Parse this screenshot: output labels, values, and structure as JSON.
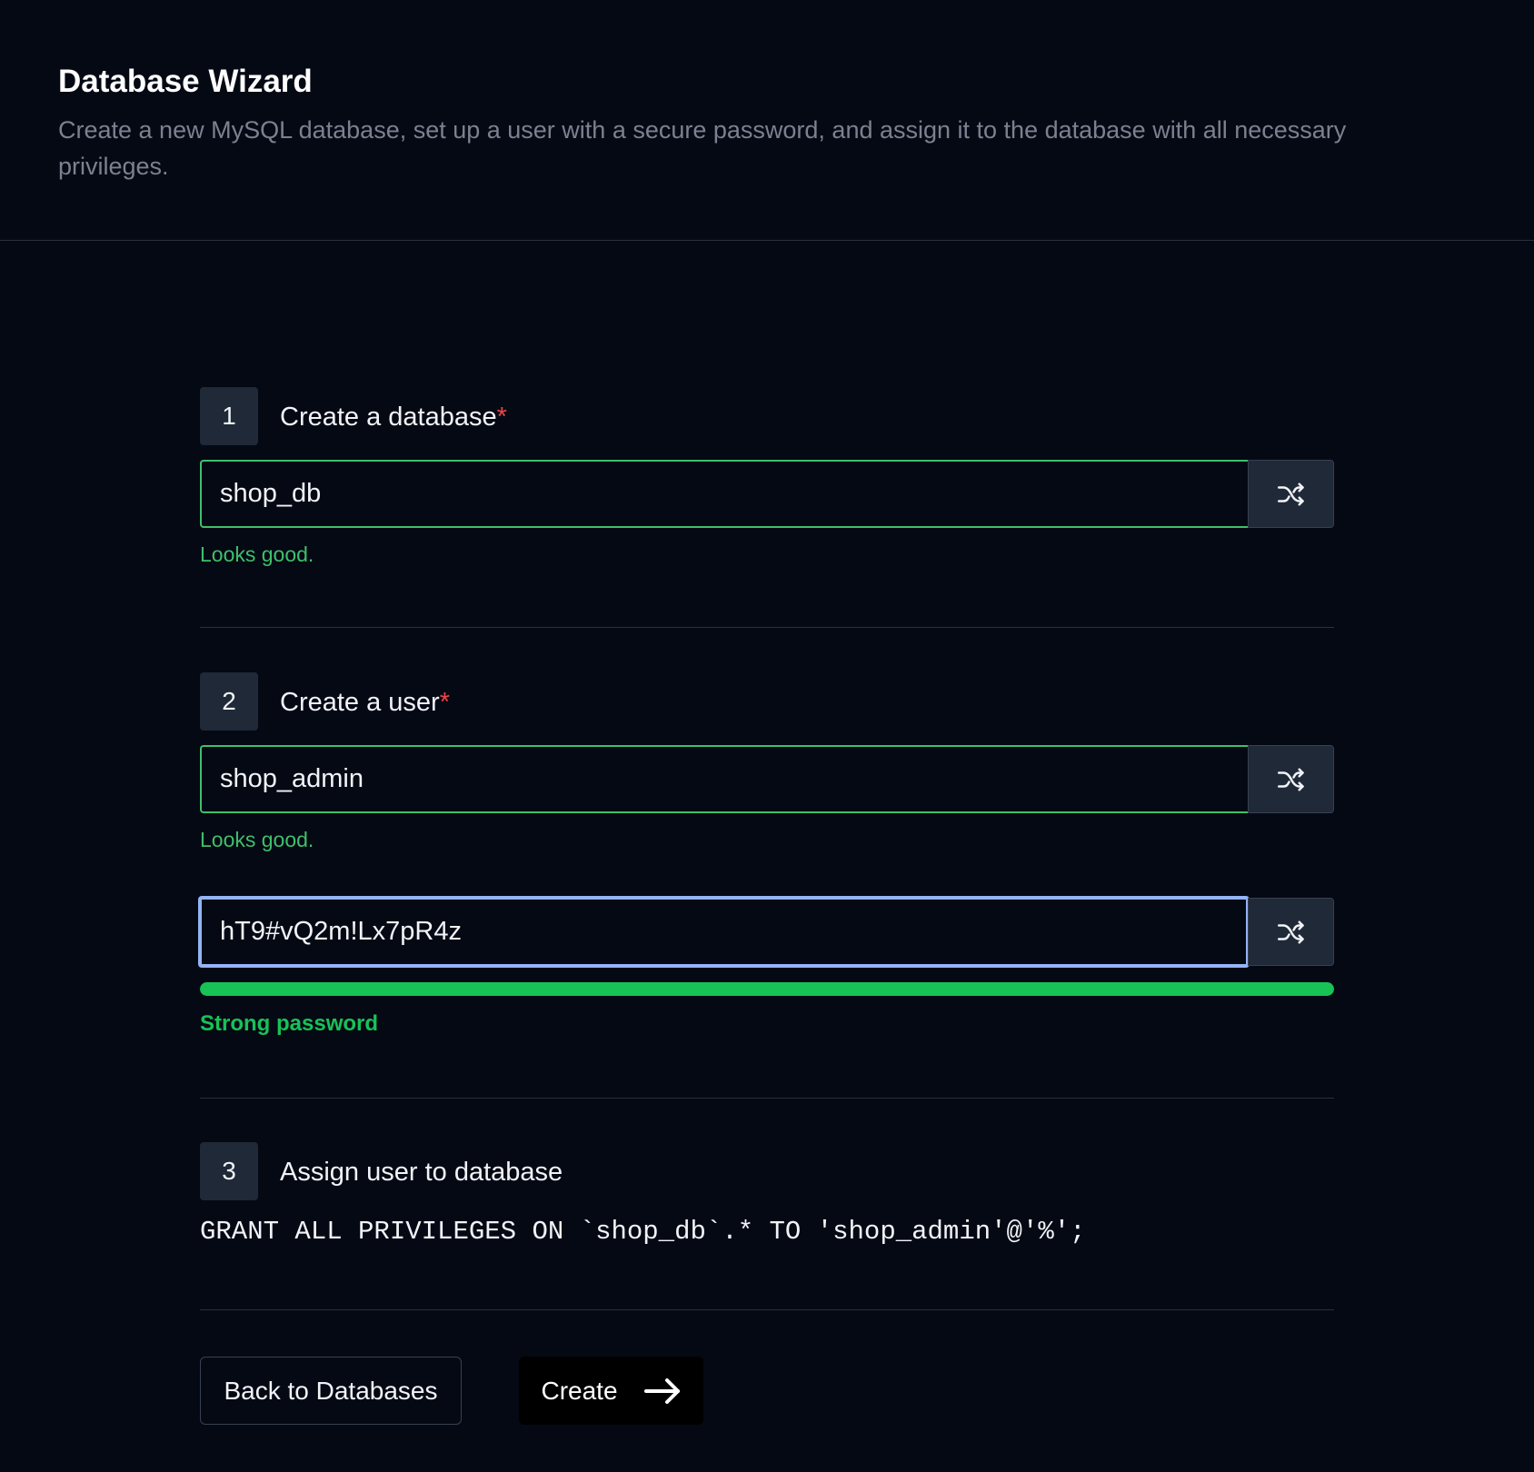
{
  "header": {
    "title": "Database Wizard",
    "subtitle": "Create a new MySQL database, set up a user with a secure password, and assign it to the database with all necessary privileges."
  },
  "steps": [
    {
      "number": "1",
      "title": "Create a database",
      "required": "*",
      "input_value": "shop_db",
      "feedback": "Looks good."
    },
    {
      "number": "2",
      "title": "Create a user",
      "required": "*",
      "input_value": "shop_admin",
      "feedback": "Looks good.",
      "password_value": "hT9#vQ2m!Lx7pR4z",
      "password_strength_label": "Strong password",
      "password_strength_fraction": 1.0
    },
    {
      "number": "3",
      "title": "Assign user to database",
      "sql": "GRANT ALL PRIVILEGES ON `shop_db`.* TO 'shop_admin'@'%';"
    }
  ],
  "actions": {
    "back_label": "Back to Databases",
    "create_label": "Create"
  },
  "icons": {
    "shuffle": "shuffle-icon",
    "arrow": "arrow-right-icon"
  },
  "colors": {
    "background": "#050914",
    "valid": "#3fbf6b",
    "strength": "#17c257",
    "required": "#ef4444",
    "focus": "#93b4f5"
  }
}
